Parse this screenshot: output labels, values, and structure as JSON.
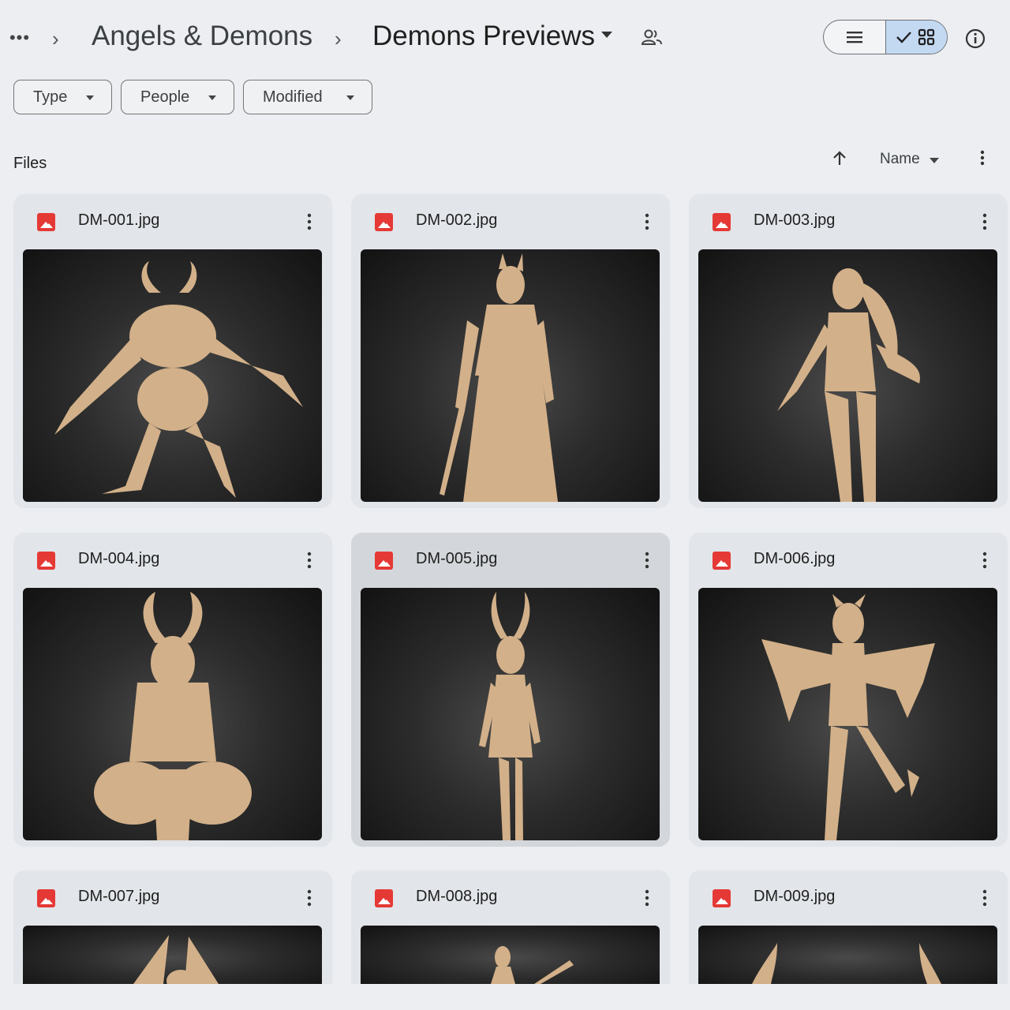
{
  "header": {
    "more_label": "•••",
    "breadcrumbs": [
      "Angels & Demons",
      "Demons Previews"
    ],
    "separator": "›",
    "shared_icon": "people-icon",
    "view_modes": [
      "list",
      "grid"
    ],
    "active_view": "grid",
    "info_icon": "info-icon"
  },
  "filters": [
    {
      "label": "Type"
    },
    {
      "label": "People"
    },
    {
      "label": "Modified"
    }
  ],
  "files_section": {
    "title": "Files",
    "sort_label": "Name",
    "sort_direction": "ascending"
  },
  "files": [
    {
      "name": "DM-001.jpg",
      "type": "image",
      "icon": "image-file-icon"
    },
    {
      "name": "DM-002.jpg",
      "type": "image",
      "icon": "image-file-icon"
    },
    {
      "name": "DM-003.jpg",
      "type": "image",
      "icon": "image-file-icon"
    },
    {
      "name": "DM-004.jpg",
      "type": "image",
      "icon": "image-file-icon"
    },
    {
      "name": "DM-005.jpg",
      "type": "image",
      "icon": "image-file-icon",
      "selected": true
    },
    {
      "name": "DM-006.jpg",
      "type": "image",
      "icon": "image-file-icon"
    },
    {
      "name": "DM-007.jpg",
      "type": "image",
      "icon": "image-file-icon"
    },
    {
      "name": "DM-008.jpg",
      "type": "image",
      "icon": "image-file-icon"
    },
    {
      "name": "DM-009.jpg",
      "type": "image",
      "icon": "image-file-icon"
    }
  ],
  "colors": {
    "accent_toggle": "#c3d9f2",
    "file_icon": "#e53935",
    "figure": "#d2b089"
  }
}
